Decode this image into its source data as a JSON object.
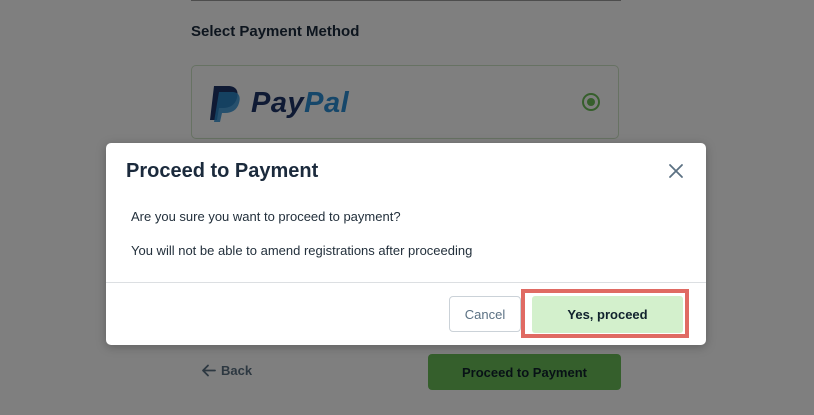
{
  "page": {
    "section_title": "Select Payment Method",
    "payment_option": {
      "brand_part1": "Pay",
      "brand_part2": "Pal",
      "selected": true
    },
    "back_label": "Back",
    "proceed_label": "Proceed to Payment"
  },
  "modal": {
    "title": "Proceed to Payment",
    "question": "Are you sure you want to proceed to payment?",
    "warning": "You will not be able to amend registrations after proceeding",
    "cancel_label": "Cancel",
    "confirm_label": "Yes, proceed"
  },
  "colors": {
    "accent_green": "#6bbf59",
    "confirm_bg": "#d3f0cc",
    "highlight_border": "#e06a63",
    "paypal_dark": "#1e3568",
    "paypal_light": "#2d8fd4"
  },
  "icons": {
    "back": "arrow-left-icon",
    "close": "close-icon",
    "paypal": "paypal-logo-icon"
  }
}
